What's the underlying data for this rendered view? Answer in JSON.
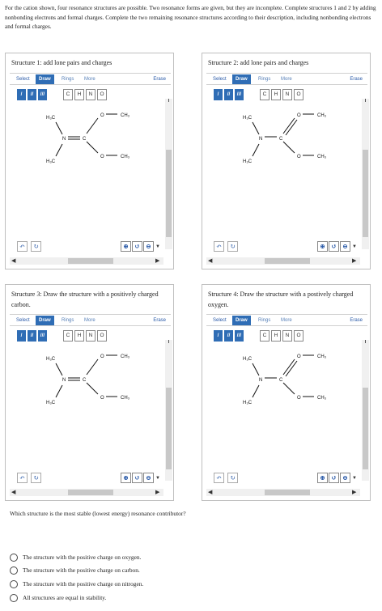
{
  "intro": "For the cation shown, four resonance structures are possible. Two resonance forms are given, but they are incomplete. Complete structures 1 and 2 by adding nonbonding electrons and formal charges. Complete the two remaining resonance structures according to their description, including nonbonding electrons and formal charges.",
  "toolbar": {
    "select": "Select",
    "draw": "Draw",
    "rings": "Rings",
    "more": "More",
    "erase": "Erase",
    "bonds": [
      "/",
      "//",
      "///"
    ],
    "atoms": [
      "C",
      "H",
      "N",
      "O"
    ]
  },
  "panels": [
    {
      "title": "Structure 1: add lone pairs and charges"
    },
    {
      "title": "Structure 2: add lone pairs and charges"
    },
    {
      "title": "Structure 3: Draw the structure with a positively charged carbon."
    },
    {
      "title": "Structure 4: Draw the structure with a postively charged oxygen."
    }
  ],
  "molecule_labels": {
    "h3c_top": "H₃C",
    "h3c_bottom": "H₃C",
    "n": "N",
    "c": "C",
    "o_top": "O",
    "o_bottom": "O",
    "ch3_top": "CH₃",
    "ch3_bottom": "CH₃"
  },
  "question": {
    "prompt": "Which structure is the most stable (lowest energy) resonance contributor?",
    "options": [
      "The structure with the positive charge on oxygen.",
      "The structure with the positive charge on carbon.",
      "The structure with the positive charge on nitrogen.",
      "All structures are equal in stability."
    ]
  },
  "icons": {
    "undo": "undo-icon",
    "redo": "redo-icon",
    "zoom_in": "zoom-in-icon",
    "zoom_reset": "zoom-reset-icon",
    "zoom_out": "zoom-out-icon"
  }
}
